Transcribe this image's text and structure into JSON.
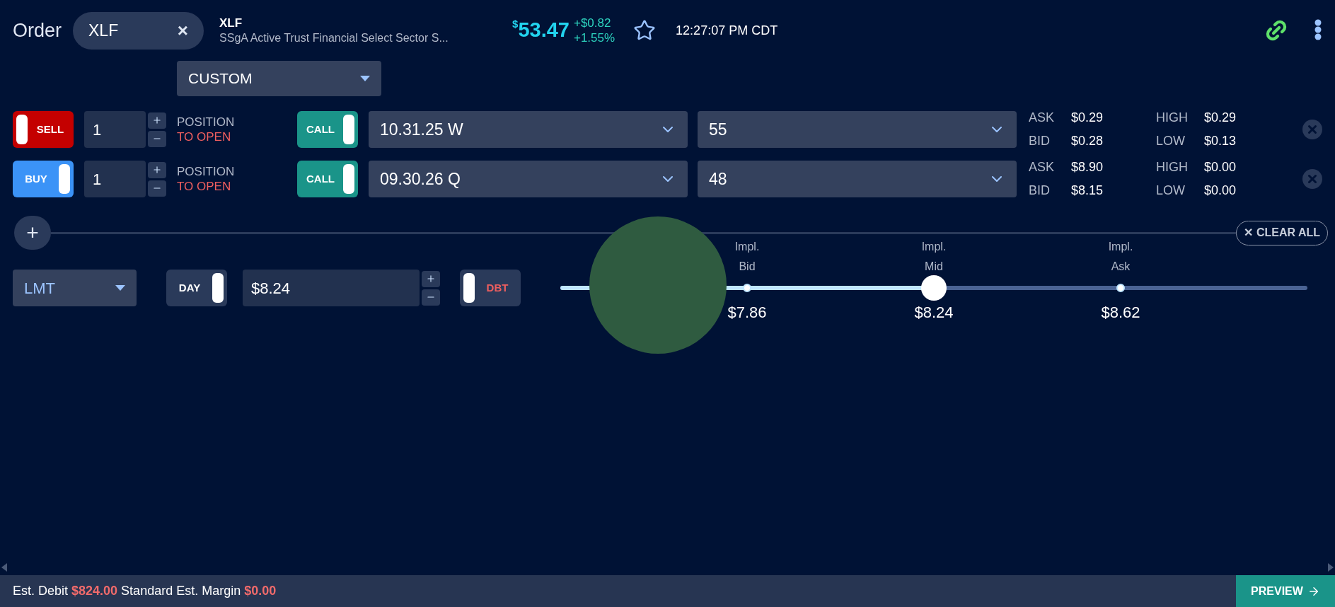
{
  "header": {
    "title": "Order",
    "symbol_chip": {
      "symbol": "XLF",
      "clear": "×"
    },
    "symbol": "XLF",
    "description": "SSgA Active Trust Financial Select Sector S...",
    "price": {
      "currency": "$",
      "value": "53.47"
    },
    "change": "+$0.82",
    "change_pct": "+1.55%",
    "favorite": false,
    "time": "12:27:07 PM CDT"
  },
  "strategy": {
    "value": "CUSTOM"
  },
  "legs": [
    {
      "action": {
        "label": "SELL",
        "color": "#c40000",
        "on": false
      },
      "quantity": "1",
      "position": "POSITION",
      "effect": "TO OPEN",
      "type": {
        "label": "CALL",
        "on": true
      },
      "expiry": "10.31.25 W",
      "strike": "55",
      "quotes": [
        {
          "label": "ASK",
          "value": "$0.29"
        },
        {
          "label": "BID",
          "value": "$0.28"
        }
      ],
      "range": [
        {
          "label": "HIGH",
          "value": "$0.29"
        },
        {
          "label": "LOW",
          "value": "$0.13"
        }
      ]
    },
    {
      "action": {
        "label": "BUY",
        "color": "#3b93f7",
        "on": true
      },
      "quantity": "1",
      "position": "POSITION",
      "effect": "TO OPEN",
      "type": {
        "label": "CALL",
        "on": true
      },
      "expiry": "09.30.26 Q",
      "strike": "48",
      "quotes": [
        {
          "label": "ASK",
          "value": "$8.90"
        },
        {
          "label": "BID",
          "value": "$8.15"
        }
      ],
      "range": [
        {
          "label": "HIGH",
          "value": "$0.00"
        },
        {
          "label": "LOW",
          "value": "$0.00"
        }
      ]
    }
  ],
  "add_leg": "+",
  "clear_all": "✕ CLEAR ALL",
  "order": {
    "type": "LMT",
    "duration": {
      "label": "DAY",
      "on": true
    },
    "price": "$8.24",
    "side": {
      "label": "DBT",
      "on": false
    }
  },
  "price_slider": {
    "level": 0.5,
    "marks": [
      {
        "label": "Impl.",
        "sub": "Bid",
        "value": "$7.86"
      },
      {
        "label": "Impl.",
        "sub": "Mid",
        "value": "$8.24"
      },
      {
        "label": "Impl.",
        "sub": "Ask",
        "value": "$8.62"
      }
    ]
  },
  "footer": {
    "estimates": [
      {
        "label": "Est. Debit",
        "value": "$824.00"
      },
      {
        "label": "Standard Est. Margin",
        "value": "$0.00"
      }
    ],
    "preview": "PREVIEW"
  }
}
